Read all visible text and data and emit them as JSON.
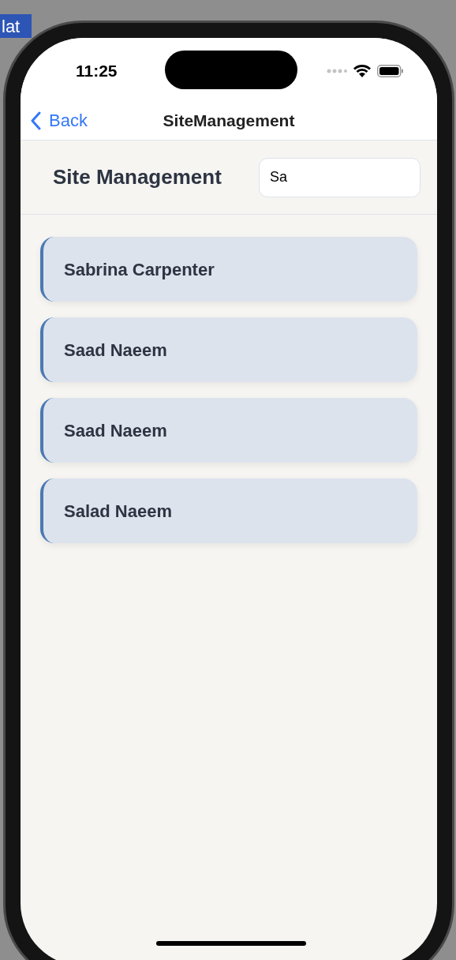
{
  "background": {
    "button_label": "lat"
  },
  "status_bar": {
    "time": "11:25"
  },
  "nav_bar": {
    "back": "Back",
    "title": "SiteManagement"
  },
  "header": {
    "title": "Site Management"
  },
  "search": {
    "value": "Sa"
  },
  "sites": [
    {
      "name": "Sabrina Carpenter"
    },
    {
      "name": "Saad Naeem"
    },
    {
      "name": "Saad Naeem"
    },
    {
      "name": "Salad Naeem"
    }
  ]
}
